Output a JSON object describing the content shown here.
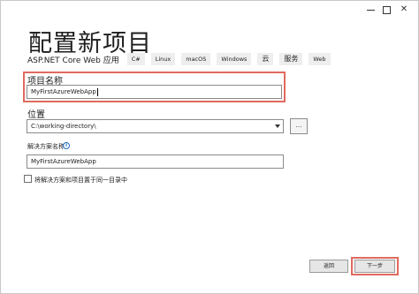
{
  "window": {
    "controls": {
      "minimize": "minimize-icon",
      "maximize": "maximize-icon",
      "close": "✕"
    }
  },
  "header": {
    "title": "配置新项目",
    "template_name": "ASP.NET Core Web 应用",
    "tags": [
      "C#",
      "Linux",
      "macOS",
      "Windows",
      "云",
      "服务",
      "Web"
    ]
  },
  "form": {
    "project_name": {
      "label": "项目名称",
      "value": "MyFirstAzureWebApp"
    },
    "location": {
      "label": "位置",
      "value": "C:\\working-directory\\",
      "browse_label": "..."
    },
    "solution_name": {
      "label": "解决方案名称",
      "info_icon": "i",
      "value": "MyFirstAzureWebApp"
    },
    "same_directory": {
      "label": "将解决方案和项目置于同一目录中",
      "checked": false
    }
  },
  "footer": {
    "back_label": "返回",
    "next_label": "下一步"
  },
  "colors": {
    "highlight": "#e06a5f",
    "info": "#1e6fc4"
  }
}
